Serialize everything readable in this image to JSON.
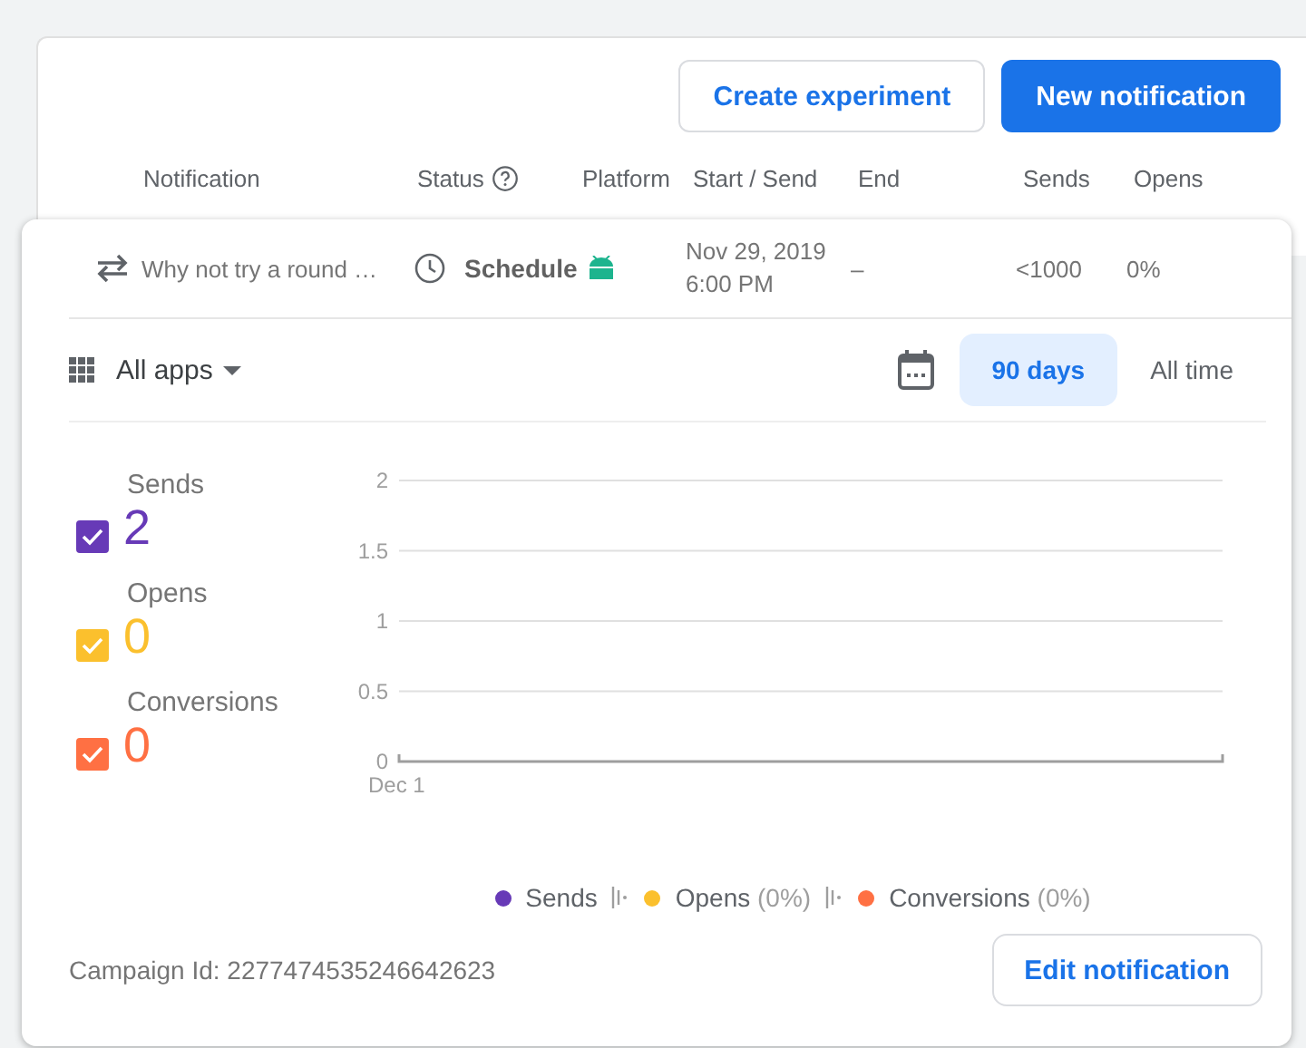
{
  "actions": [
    {
      "label": "Create experiment",
      "kind": "outlined"
    },
    {
      "label": "New notification",
      "kind": "filled"
    }
  ],
  "table": {
    "columns": [
      {
        "label": "Notification"
      },
      {
        "label": "Status",
        "help": true
      },
      {
        "label": "Platform"
      },
      {
        "label": "Start / Send"
      },
      {
        "label": "End"
      },
      {
        "label": "Sends"
      },
      {
        "label": "Opens"
      }
    ],
    "row": {
      "notification": "Why not try a round …",
      "status": "Schedule",
      "start_date": "Nov 29, 2019",
      "start_time": "6:00 PM",
      "end": "–",
      "sends": "<1000",
      "opens": "0%"
    }
  },
  "filters": {
    "app": "All apps",
    "ranges": [
      {
        "label": "90 days",
        "selected": true
      },
      {
        "label": "All time",
        "selected": false
      }
    ]
  },
  "metrics": [
    {
      "label": "Sends",
      "value": "2",
      "checked": true,
      "color": "#673ab7"
    },
    {
      "label": "Opens",
      "value": "0",
      "checked": true,
      "color": "#fbc02d"
    },
    {
      "label": "Conversions",
      "value": "0",
      "checked": true,
      "color": "#ff7043"
    }
  ],
  "chart_data": {
    "type": "line",
    "grid": true,
    "categories": [
      "Dec 1"
    ],
    "ylim": [
      0,
      2
    ],
    "yticks": [
      0,
      {
        "value": 0.5,
        "label": "0.5"
      },
      1,
      {
        "value": 1.5,
        "label": "1.5"
      },
      2
    ],
    "ref_lines": [
      {
        "axis": "y",
        "value": 0
      }
    ],
    "series": [
      {
        "color": "#673ab7",
        "values": [
          null
        ]
      },
      {
        "color": "#fbc02d",
        "values": [
          null
        ]
      },
      {
        "color": "#ff7043",
        "values": [
          null
        ]
      }
    ]
  },
  "legend": [
    {
      "label": "Sends"
    },
    {
      "label": "Opens",
      "share": "(0%)"
    },
    {
      "label": "Conversions",
      "share": "(0%)"
    }
  ],
  "campaign_id": "Campaign Id: 2277474535246642623",
  "edit_button": "Edit notification"
}
